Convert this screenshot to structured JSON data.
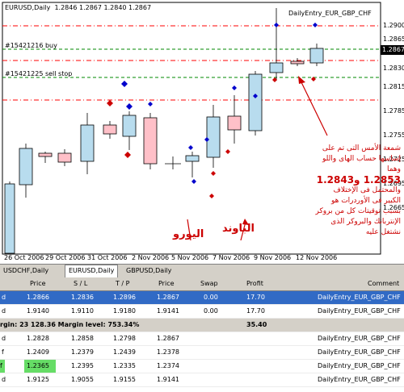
{
  "chart": {
    "title": "EURUSD,Daily",
    "ohlc": "1.2846 1.2867 1.2840 1.2867",
    "ea_name": "DailyEntry_EUR_GBP_CHF",
    "order_buy": "#15421216 buy",
    "order_sell": "#15421225 sell stop",
    "price_labels": [
      "1.2900",
      "1.2865",
      "1.2867",
      "1.2830",
      "1.2815",
      "1.2785",
      "1.2755",
      "1.2725",
      "1.2695",
      "1.2665"
    ],
    "current_price": "1.2867",
    "date_labels": [
      "26 Oct 2006",
      "29 Oct 2006",
      "31 Oct 2006",
      "2 Nov 2006",
      "5 Nov 2006",
      "7 Nov 2006",
      "9 Nov 2006",
      "12 Nov 2006"
    ]
  },
  "annotation": {
    "line1": "شمعة الأمس التى تم على",
    "line2": "إساسها حساب الهاى واللو",
    "line3": "وهما",
    "values": "1.2853 و1.2843",
    "line5": "والمحتمل فى الإختلاف",
    "line6": "الكبير فى الأوردرات هو",
    "line7": "بسبب توقيتات كل من بروكر",
    "line8": "الإنتربانك والبروكر الذى",
    "line9": "نشتغل عليه"
  },
  "labels": {
    "euro": "اليورو",
    "pound": "الباوند"
  },
  "tabs": [
    "USDCHF,Daily",
    "EURUSD,Daily",
    "GBPUSD,Daily"
  ],
  "columns": [
    "Price",
    "S / L",
    "T / P",
    "Price",
    "Swap",
    "Profit",
    "Comment"
  ],
  "rows": [
    {
      "type": "d",
      "price": "1.2866",
      "sl": "1.2836",
      "tp": "1.2896",
      "cur": "1.2867",
      "swap": "0.00",
      "profit": "17.70",
      "comment": "DailyEntry_EUR_GBP_CHF"
    },
    {
      "type": "d",
      "price": "1.9140",
      "sl": "1.9110",
      "tp": "1.9180",
      "cur": "1.9141",
      "swap": "0.00",
      "profit": "17.70",
      "comment": "DailyEntry_EUR_GBP_CHF"
    }
  ],
  "summary": {
    "text": "rgin: 23 128.36  Margin level: 753.34%",
    "profit": "35.40"
  },
  "pending": [
    {
      "type": "d",
      "price": "1.2828",
      "sl": "1.2858",
      "tp": "1.2798",
      "cur": "1.2867",
      "comment": "DailyEntry_EUR_GBP_CHF"
    },
    {
      "type": "f",
      "price": "1.2409",
      "sl": "1.2379",
      "tp": "1.2439",
      "cur": "1.2378",
      "comment": "DailyEntry_EUR_GBP_CHF"
    },
    {
      "type": "f",
      "price": "1.2365",
      "sl": "1.2395",
      "tp": "1.2335",
      "cur": "1.2374",
      "comment": "DailyEntry_EUR_GBP_CHF"
    },
    {
      "type": "d",
      "price": "1.9125",
      "sl": "1.9055",
      "tp": "1.9155",
      "cur": "1.9141",
      "comment": "DailyEntry_EUR_GBP_CHF"
    }
  ],
  "colors": {
    "bull": "#b8dcee",
    "bear": "#ffc0c8",
    "buyline": "#008800",
    "sellline": "#008800",
    "tpsl": "#ff0000",
    "accent": "#cc0000",
    "selected": "#316ac5"
  }
}
